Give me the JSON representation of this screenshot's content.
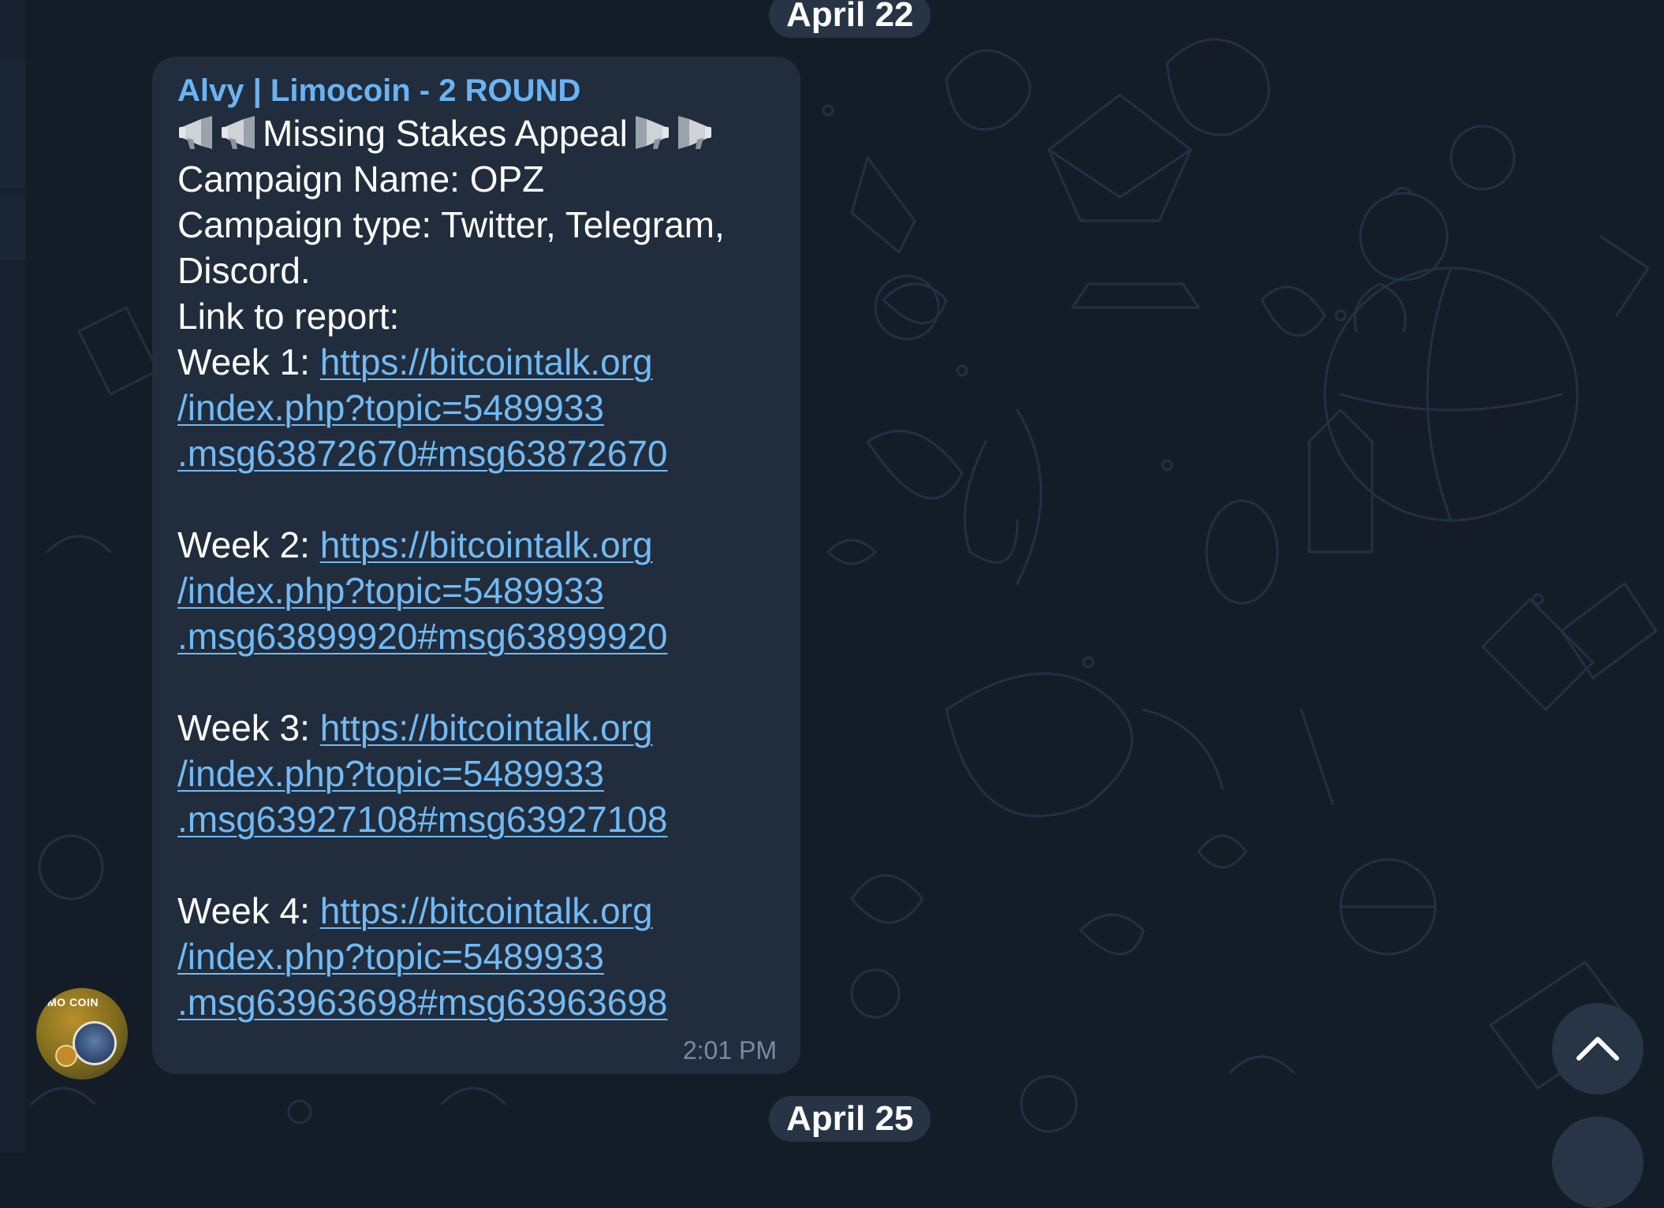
{
  "dates": {
    "top": "April 22",
    "bottom": "April 25"
  },
  "message": {
    "sender": "Alvy | Limocoin - 2 ROUND",
    "title": "Missing Stakes Appeal",
    "title_icon": "megaphone-icon",
    "campaign_name": "Campaign Name: OPZ",
    "campaign_type_line1": "Campaign type: Twitter, Telegram,",
    "campaign_type_line2": "Discord.",
    "report_label": "Link to report:",
    "weeks": [
      {
        "label": "Week 1: ",
        "link_line1": "https://bitcointalk.org",
        "link_line2": "/index.php?topic=5489933",
        "link_line3": ".msg63872670#msg63872670"
      },
      {
        "label": "Week 2: ",
        "link_line1": "https://bitcointalk.org",
        "link_line2": "/index.php?topic=5489933",
        "link_line3": ".msg63899920#msg63899920"
      },
      {
        "label": "Week 3: ",
        "link_line1": "https://bitcointalk.org",
        "link_line2": "/index.php?topic=5489933",
        "link_line3": ".msg63927108#msg63927108"
      },
      {
        "label": "Week 4: ",
        "link_line1": "https://bitcointalk.org",
        "link_line2": "/index.php?topic=5489933",
        "link_line3": ".msg63963698#msg63963698"
      }
    ],
    "time": "2:01 PM"
  },
  "avatar": {
    "text": "MO COIN",
    "icon": "limocoin-avatar"
  },
  "scroll_button": {
    "icon": "chevron-up-icon"
  },
  "colors": {
    "background": "#141c28",
    "bubble": "#212d3c",
    "sender": "#6ab3f3",
    "link": "#71baf5",
    "text": "#ffffff",
    "timestamp": "#7b8a9c",
    "pill": "#273446"
  }
}
